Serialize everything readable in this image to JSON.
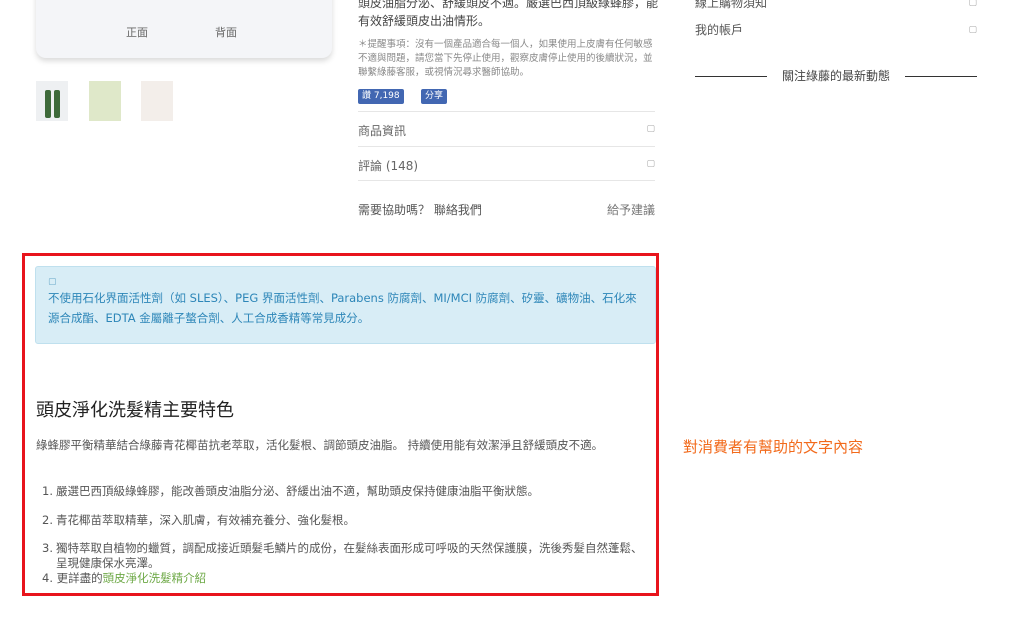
{
  "product_image": {
    "front_label": "正面",
    "back_label": "背面"
  },
  "description_tail": "頭皮油脂分泌、舒緩頭皮不適。嚴選巴西頂級綠蜂膠，能有效舒緩頭皮出油情形。",
  "warning_note": "＊提醒事項：沒有一個產品適合每一個人，如果使用上皮膚有任何敏感不適與問題，請您當下先停止使用，觀察皮膚停止使用的後續狀況，並聯繫綠藤客服，或視情況尋求醫師協助。",
  "facebook": {
    "like_label": "讚 7,198",
    "share_label": "分享"
  },
  "accordion": [
    {
      "label": "商品資訊",
      "chevron": "▢"
    },
    {
      "label": "評論 (148)",
      "chevron": "▢"
    }
  ],
  "help": {
    "question": "需要協助嗎？ 聯絡我們",
    "suggest": "給予建議"
  },
  "sidebar": {
    "items": [
      {
        "label": "線上購物須知",
        "chevron": "▢"
      },
      {
        "label": "我的帳戶",
        "chevron": "▢"
      }
    ],
    "follow_heading": "關注綠藤的最新動態"
  },
  "info_alert": {
    "icon": "▢",
    "text": "不使用石化界面活性劑（如 SLES）、PEG 界面活性劑、Parabens 防腐劑、MI/MCI 防腐劑、矽靈、礦物油、石化來源合成酯、EDTA 金屬離子螯合劑、人工合成香精等常見成分。"
  },
  "features": {
    "title": "頭皮淨化洗髮精主要特色",
    "intro": "綠蜂膠平衡精華結合綠藤青花椰苗抗老萃取，活化髮根、調節頭皮油脂。 持續使用能有效潔淨且舒緩頭皮不適。",
    "items": [
      {
        "num": "1.",
        "text": "嚴選巴西頂級綠蜂膠，能改善頭皮油脂分泌、舒緩出油不適，幫助頭皮保持健康油脂平衡狀態。"
      },
      {
        "num": "2.",
        "text": "青花椰苗萃取精華，深入肌膚，有效補充養分、強化髮根。"
      },
      {
        "num": "3.",
        "text": "獨特萃取自植物的蠟質，調配成接近頭髮毛鱗片的成份，在髮絲表面形成可呼吸的天然保護膜，洗後秀髮自然蓬鬆、呈現健康保水亮澤。"
      }
    ],
    "more_prefix": "4. 更詳盡的",
    "more_link": "頭皮淨化洗髮精介紹"
  },
  "annotation": "對消費者有幫助的文字內容",
  "colors": {
    "highlight_border": "#e8141c",
    "annotation": "#f26a1b",
    "alert_bg": "#d8edf6",
    "alert_text": "#2d86b8",
    "link_green": "#6ea947",
    "facebook_blue": "#4267b2"
  }
}
